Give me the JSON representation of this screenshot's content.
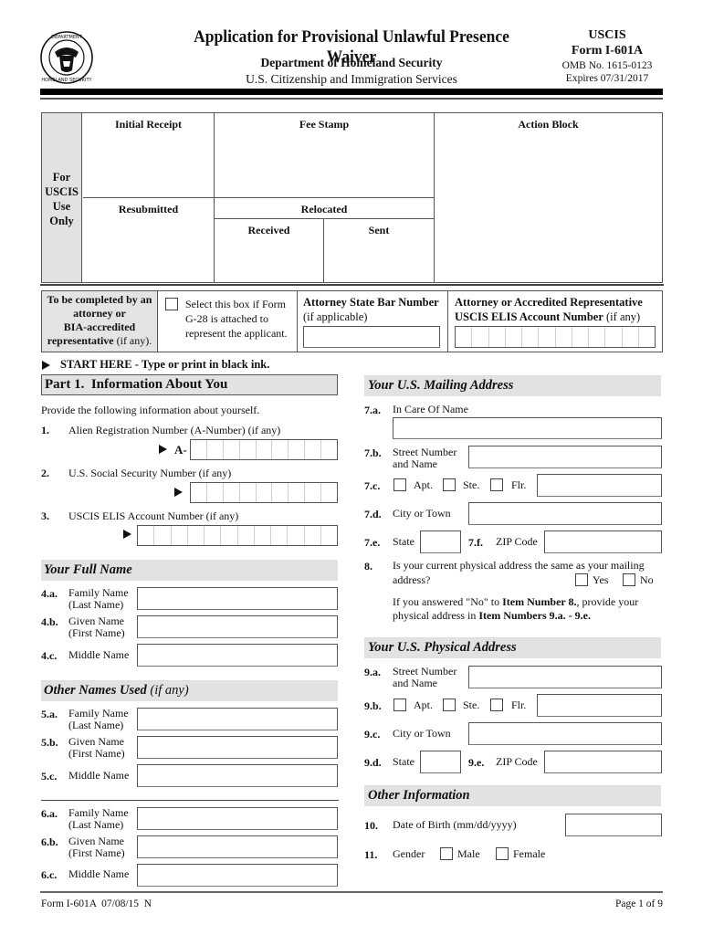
{
  "header": {
    "title": "Application for Provisional Unlawful Presence Waiver",
    "department": "Department of Homeland Security",
    "agency": "U.S. Citizenship and Immigration Services",
    "uscis": "USCIS",
    "form_number": "Form I-601A",
    "omb": "OMB No. 1615-0123",
    "expires": "Expires 07/31/2017",
    "seal_icon": "dhs-seal-icon"
  },
  "uscis_box": {
    "side_label": [
      "For",
      "USCIS",
      "Use",
      "Only"
    ],
    "initial_receipt": "Initial Receipt",
    "fee_stamp": "Fee Stamp",
    "action_block": "Action Block",
    "resubmitted": "Resubmitted",
    "relocated": "Relocated",
    "received": "Received",
    "sent": "Sent"
  },
  "attorney_box": {
    "label_line1": "To be completed by an",
    "label_line2": "attorney or",
    "label_line3": "BIA-accredited",
    "label_line4_bold": "representative",
    "label_line4_rest": " (if any).",
    "g28_text_1": "Select this box if Form",
    "g28_text_2": "G-28 is attached to",
    "g28_text_3": "represent the applicant.",
    "bar_number_label": "Attorney State Bar Number",
    "bar_number_sub": "(if applicable)",
    "bar_number_value": "",
    "elis_label_1": "Attorney or Accredited Representative",
    "elis_label_2_bold": "USCIS ELIS Account Number",
    "elis_label_2_rest": " (if any)",
    "elis_cells": 12
  },
  "start_here": "START HERE - Type or print in black ink.",
  "part1": {
    "title": "Part 1.  Information About You",
    "intro": "Provide the following information about yourself.",
    "items": {
      "q1_num": "1.",
      "q1_label": "Alien Registration Number (A-Number) (if any)",
      "q1_prefix": "A-",
      "q1_cells": 9,
      "q2_num": "2.",
      "q2_label": "U.S. Social Security Number (if any)",
      "q2_cells": 9,
      "q3_num": "3.",
      "q3_label": "USCIS ELIS Account Number (if any)",
      "q3_cells": 12
    }
  },
  "full_name": {
    "title": "Your Full Name",
    "fields": [
      {
        "num": "4.a.",
        "label1": "Family Name",
        "label2": "(Last Name)",
        "value": ""
      },
      {
        "num": "4.b.",
        "label1": "Given Name",
        "label2": "(First Name)",
        "value": ""
      },
      {
        "num": "4.c.",
        "label1": "Middle Name",
        "label2": "",
        "value": ""
      }
    ]
  },
  "other_names": {
    "title": "Other Names Used",
    "title_suffix": " (if any)",
    "set1": [
      {
        "num": "5.a.",
        "label1": "Family Name",
        "label2": "(Last Name)",
        "value": ""
      },
      {
        "num": "5.b.",
        "label1": "Given Name",
        "label2": "(First Name)",
        "value": ""
      },
      {
        "num": "5.c.",
        "label1": "Middle Name",
        "label2": "",
        "value": ""
      }
    ],
    "set2": [
      {
        "num": "6.a.",
        "label1": "Family Name",
        "label2": "(Last Name)",
        "value": ""
      },
      {
        "num": "6.b.",
        "label1": "Given Name",
        "label2": "(First Name)",
        "value": ""
      },
      {
        "num": "6.c.",
        "label1": "Middle Name",
        "label2": "",
        "value": ""
      }
    ]
  },
  "mailing": {
    "title": "Your U.S. Mailing Address",
    "care_of_num": "7.a.",
    "care_of_label": "In Care Of Name",
    "street_num": "7.b.",
    "street_label1": "Street Number",
    "street_label2": "and Name",
    "unit_num": "7.c.",
    "apt": "Apt.",
    "ste": "Ste.",
    "flr": "Flr.",
    "city_num": "7.d.",
    "city_label": "City or Town",
    "state_num": "7.e.",
    "state_label": "State",
    "zip_num": "7.f.",
    "zip_label": "ZIP Code"
  },
  "q8": {
    "num": "8.",
    "text1": "Is your current physical address the same as your mailing",
    "text2": "address?",
    "yes": "Yes",
    "no": "No",
    "note_a": "If you answered \"No\" to ",
    "note_b": "Item Number 8.",
    "note_c": ", provide your",
    "note_d": "physical address in ",
    "note_e": "Item Numbers 9.a. - 9.e."
  },
  "physical": {
    "title": "Your U.S. Physical Address",
    "street_num": "9.a.",
    "street_label1": "Street Number",
    "street_label2": "and Name",
    "unit_num": "9.b.",
    "apt": "Apt.",
    "ste": "Ste.",
    "flr": "Flr.",
    "city_num": "9.c.",
    "city_label": "City or Town",
    "state_num": "9.d.",
    "state_label": "State",
    "zip_num": "9.e.",
    "zip_label": "ZIP Code"
  },
  "other_info": {
    "title": "Other Information",
    "dob_num": "10.",
    "dob_label": "Date of Birth (mm/dd/yyyy)",
    "gender_num": "11.",
    "gender_label": "Gender",
    "male": "Male",
    "female": "Female"
  },
  "footer": {
    "left": "Form I-601A  07/08/15  N",
    "right": "Page 1 of 9"
  }
}
